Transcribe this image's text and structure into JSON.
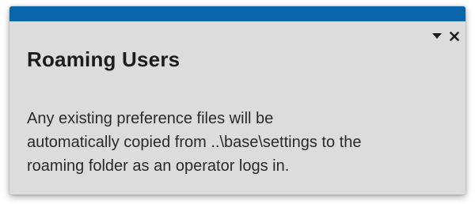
{
  "panel": {
    "title": "Roaming Users",
    "body_lines": [
      "Any existing preference files will be",
      "automatically copied from ..\\base\\settings to the",
      "roaming folder as an operator logs in."
    ],
    "controls": {
      "dropdown_icon": "chevron-down-icon",
      "close_icon": "close-icon"
    },
    "colors": {
      "accent": "#0a66a8",
      "background": "#dcdcdc",
      "text": "#1c1c1c"
    }
  }
}
